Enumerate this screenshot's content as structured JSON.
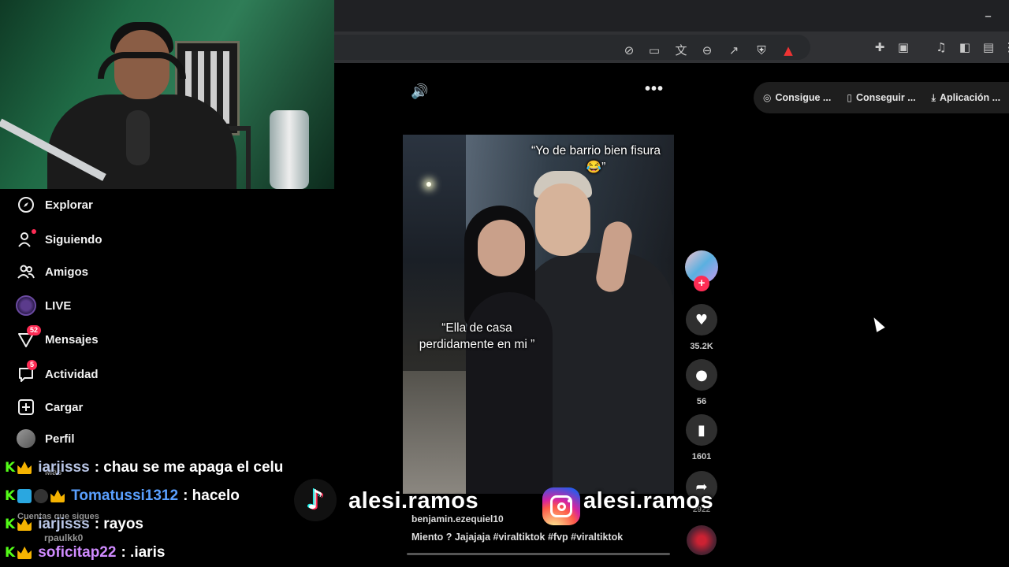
{
  "browser": {
    "minimize_glyph": "–",
    "toolbar_icons": [
      "no-translate-icon",
      "cast-icon",
      "translate-icon",
      "zoom-icon",
      "share-icon",
      "brave-shield-icon",
      "brave-rewards-icon",
      "extensions-icon",
      "sidepanel-icon",
      "media-icon",
      "sidebar-icon",
      "wallet-icon"
    ]
  },
  "sidebar": {
    "items": [
      {
        "label": "Explorar",
        "icon": "compass-icon"
      },
      {
        "label": "Siguiendo",
        "icon": "following-icon"
      },
      {
        "label": "Amigos",
        "icon": "friends-icon"
      },
      {
        "label": "LIVE",
        "icon": "live-icon"
      },
      {
        "label": "Mensajes",
        "icon": "messages-icon",
        "badge": "52"
      },
      {
        "label": "Actividad",
        "icon": "activity-icon",
        "badge": "5"
      },
      {
        "label": "Cargar",
        "icon": "upload-icon"
      },
      {
        "label": "Perfil",
        "icon": "profile-avatar"
      }
    ],
    "more_label": "Más",
    "following_heading": "Cuentas que sigues",
    "following_account": "rpaulkk0"
  },
  "chat": [
    {
      "user": "iarjisss",
      "message": ": chau se me apaga el celu",
      "user_color": "#b9c6e6"
    },
    {
      "user": "Tomatussi1312",
      "message": ": hacelo",
      "user_color": "#5aa0ff"
    },
    {
      "user": "iarjisss",
      "message": ": rayos",
      "user_color": "#b9c6e6"
    },
    {
      "user": "soficitap22",
      "message": ": .iaris",
      "user_color": "#d08bff"
    }
  ],
  "pills": [
    {
      "label": "Consigue ...",
      "icon": "coin-icon"
    },
    {
      "label": "Conseguir ...",
      "icon": "phone-icon"
    },
    {
      "label": "Aplicación ...",
      "icon": "download-icon"
    }
  ],
  "video": {
    "caption_top_line1": "“Yo de barrio bien fisura",
    "caption_top_emoji": "😂”",
    "caption_mid_line1": "“Ella de casa",
    "caption_mid_line2": "perdidamente en mi ”",
    "author": "benjamin.ezequiel10",
    "description": "Miento ? Jajajaja #viraltiktok #fvp #viraltiktok",
    "likes": "35.2K",
    "comments": "56",
    "saves": "1601",
    "shares": "2922"
  },
  "overlay": {
    "tiktok_handle": "alesi.ramos",
    "instagram_handle": "alesi.ramos"
  },
  "colors": {
    "accent": "#fe2c55",
    "kick_green": "#53fc18",
    "background": "#000000"
  }
}
